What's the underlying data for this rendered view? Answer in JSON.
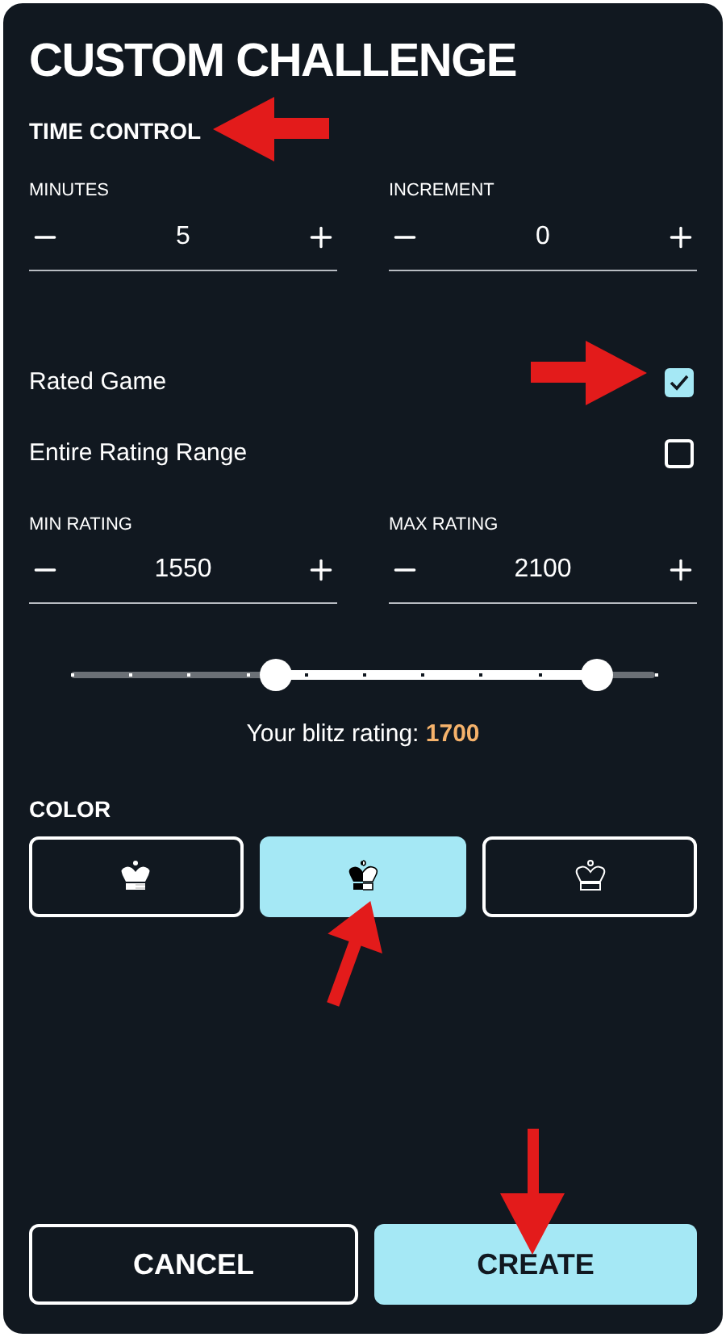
{
  "title": "CUSTOM CHALLENGE",
  "time_control": {
    "heading": "TIME CONTROL",
    "steppers": [
      {
        "label": "MINUTES",
        "value": "5"
      },
      {
        "label": "INCREMENT",
        "value": "0"
      }
    ]
  },
  "options": [
    {
      "label": "Rated Game",
      "checked": true
    },
    {
      "label": "Entire Rating Range",
      "checked": false
    }
  ],
  "rating": {
    "steppers": [
      {
        "label": "MIN RATING",
        "value": "1550"
      },
      {
        "label": "MAX RATING",
        "value": "2100"
      }
    ],
    "slider": {
      "low": {
        "level": 0.35
      },
      "high": {
        "level": 0.9
      }
    },
    "caption": "Your blitz rating: ",
    "value": "1700"
  },
  "color": {
    "heading": "COLOR",
    "choices": [
      {
        "kind": "white",
        "selected": false
      },
      {
        "kind": "random",
        "selected": true
      },
      {
        "kind": "black",
        "selected": false
      }
    ]
  },
  "buttons": [
    {
      "label": "CANCEL",
      "kind": "secondary"
    },
    {
      "label": "CREATE",
      "kind": "primary"
    }
  ]
}
